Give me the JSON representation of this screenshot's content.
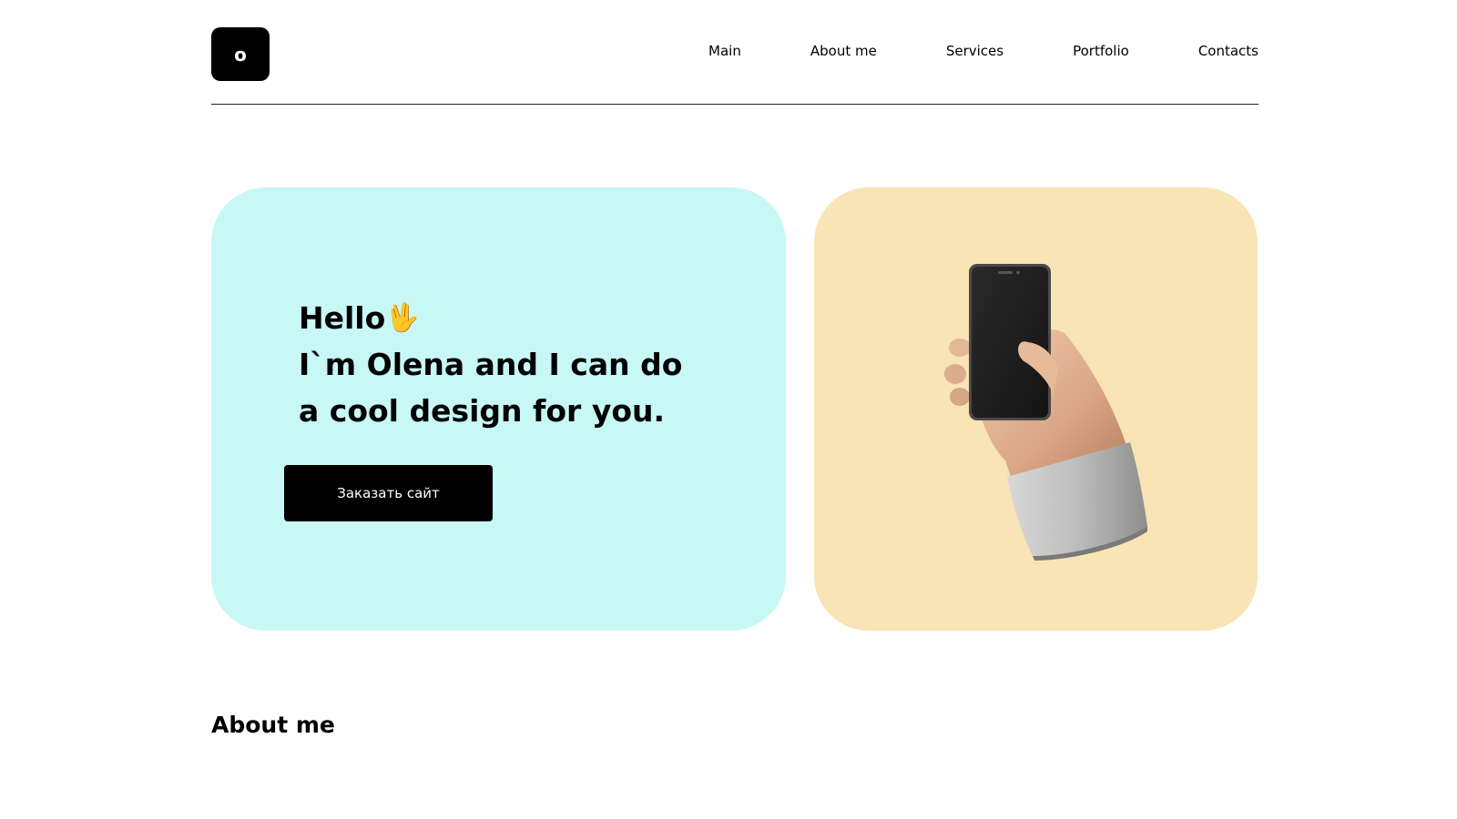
{
  "header": {
    "logo_letter": "o",
    "nav": [
      {
        "label": "Main"
      },
      {
        "label": "About me"
      },
      {
        "label": "Services"
      },
      {
        "label": "Portfolio"
      },
      {
        "label": "Contacts"
      }
    ]
  },
  "hero": {
    "greeting": "Hello",
    "greeting_emoji": "🖖",
    "line2": "I`m Olena and I can do",
    "line3": "a cool design for you.",
    "cta_label": "Заказать сайт",
    "left_card_color": "#c8f8f6",
    "right_card_color": "#f8e4b4",
    "illustration_icon": "hand-holding-phone-icon"
  },
  "about": {
    "title": "About me"
  }
}
